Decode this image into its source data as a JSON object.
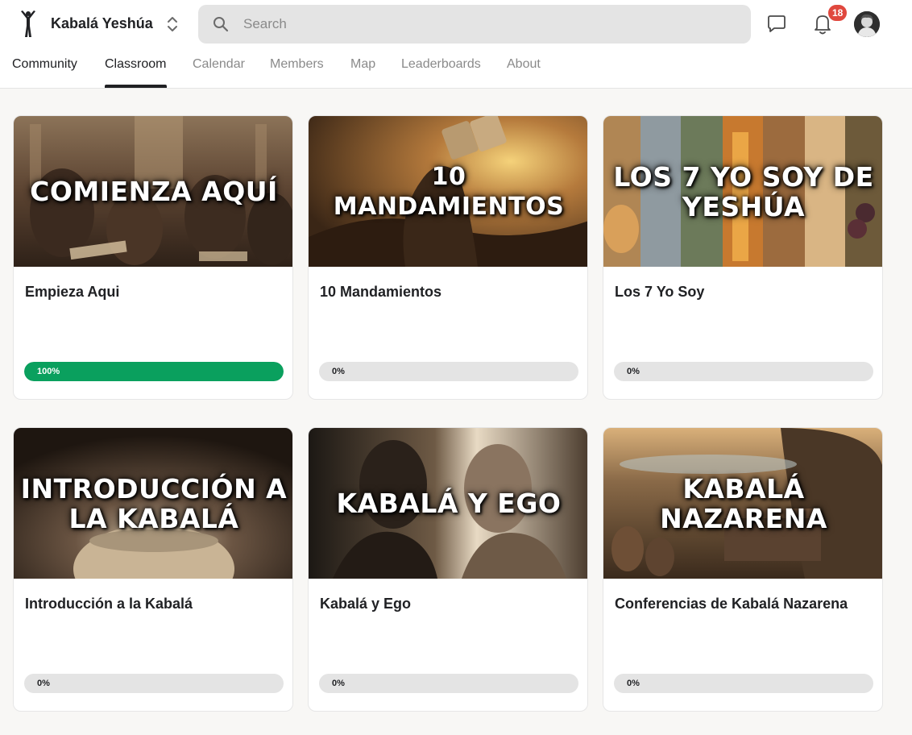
{
  "header": {
    "group_name": "Kabalá Yeshúa",
    "search_placeholder": "Search",
    "notifications_count": "18"
  },
  "nav": {
    "tabs": [
      {
        "label": "Community"
      },
      {
        "label": "Classroom"
      },
      {
        "label": "Calendar"
      },
      {
        "label": "Members"
      },
      {
        "label": "Map"
      },
      {
        "label": "Leaderboards"
      },
      {
        "label": "About"
      }
    ],
    "active_tab": "Classroom"
  },
  "courses": [
    {
      "cover_text": "COMIENZA AQUÍ",
      "title": "Empieza Aqui",
      "progress_label": "100%",
      "progress": 100
    },
    {
      "cover_text": "10 MANDAMIENTOS",
      "title": "10 Mandamientos",
      "progress_label": "0%",
      "progress": 0
    },
    {
      "cover_text": "LOS 7 YO SOY DE YESHÚA",
      "title": "Los 7 Yo Soy",
      "progress_label": "0%",
      "progress": 0
    },
    {
      "cover_text": "INTRODUCCIÓN A LA KABALÁ",
      "title": "Introducción a la Kabalá",
      "progress_label": "0%",
      "progress": 0
    },
    {
      "cover_text": "KABALÁ Y EGO",
      "title": "Kabalá y Ego",
      "progress_label": "0%",
      "progress": 0
    },
    {
      "cover_text": "KABALÁ NAZARENA",
      "title": "Conferencias de Kabalá Nazarena",
      "progress_label": "0%",
      "progress": 0
    }
  ],
  "colors": {
    "progress_complete": "#0aa05e",
    "progress_track": "#e4e4e4",
    "badge": "#e0483e"
  },
  "icons": {
    "logo": "figure-logo-icon",
    "switcher": "chevron-up-down-icon",
    "search": "search-icon",
    "chat": "chat-bubble-icon",
    "notifications": "bell-icon",
    "avatar": "user-avatar"
  }
}
